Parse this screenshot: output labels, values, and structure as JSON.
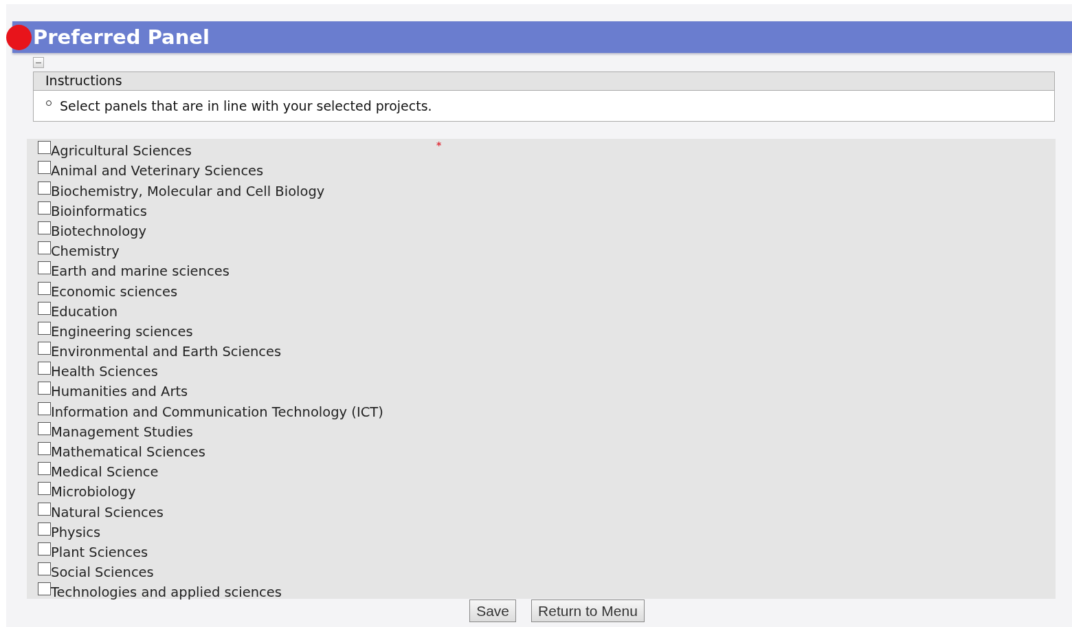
{
  "header": {
    "title": "Preferred Panel"
  },
  "instructions": {
    "expanded": true,
    "title": "Instructions",
    "items": [
      "Select panels that are in line with your selected projects."
    ]
  },
  "panels": {
    "required_mark": "*",
    "options": [
      {
        "label": "Agricultural Sciences",
        "checked": false
      },
      {
        "label": "Animal and Veterinary Sciences",
        "checked": false
      },
      {
        "label": "Biochemistry, Molecular and Cell Biology",
        "checked": false
      },
      {
        "label": "Bioinformatics",
        "checked": false
      },
      {
        "label": "Biotechnology",
        "checked": false
      },
      {
        "label": "Chemistry",
        "checked": false
      },
      {
        "label": "Earth and marine sciences",
        "checked": false
      },
      {
        "label": "Economic sciences",
        "checked": false
      },
      {
        "label": "Education",
        "checked": false
      },
      {
        "label": "Engineering sciences",
        "checked": false
      },
      {
        "label": "Environmental and Earth Sciences",
        "checked": false
      },
      {
        "label": "Health Sciences",
        "checked": false
      },
      {
        "label": "Humanities and Arts",
        "checked": false
      },
      {
        "label": "Information and Communication Technology (ICT)",
        "checked": false
      },
      {
        "label": "Management Studies",
        "checked": false
      },
      {
        "label": "Mathematical Sciences",
        "checked": false
      },
      {
        "label": "Medical Science",
        "checked": false
      },
      {
        "label": "Microbiology",
        "checked": false
      },
      {
        "label": "Natural Sciences",
        "checked": false
      },
      {
        "label": "Physics",
        "checked": false
      },
      {
        "label": "Plant Sciences",
        "checked": false
      },
      {
        "label": "Social Sciences",
        "checked": false
      },
      {
        "label": "Technologies and applied sciences",
        "checked": false
      }
    ]
  },
  "buttons": [
    "Save",
    "Return to Menu"
  ]
}
